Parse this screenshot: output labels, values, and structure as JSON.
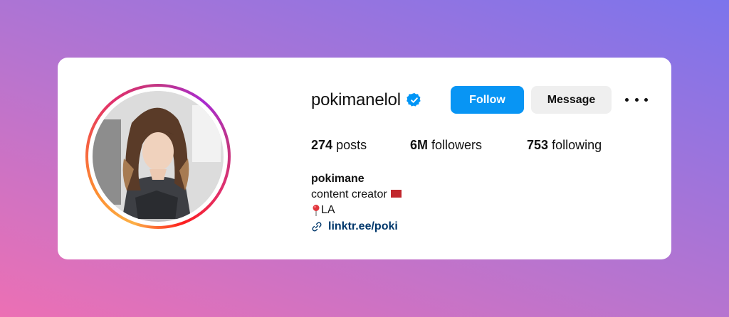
{
  "profile": {
    "username": "pokimanelol",
    "verified": true,
    "follow_label": "Follow",
    "message_label": "Message",
    "more_icon": "more-horizontal-icon"
  },
  "stats": {
    "posts_count": "274",
    "posts_label": "posts",
    "followers_count": "6M",
    "followers_label": "followers",
    "following_count": "753",
    "following_label": "following"
  },
  "bio": {
    "name": "pokimane",
    "line1": "content creator",
    "line1_emoji": "flag-morocco",
    "line2_emoji": "round-pushpin",
    "line2": "LA",
    "link": "linktr.ee/poki"
  },
  "colors": {
    "follow_button": "#0895f4",
    "message_button": "#efefef",
    "verified_badge": "#0095f6",
    "link_text": "#00376b"
  }
}
